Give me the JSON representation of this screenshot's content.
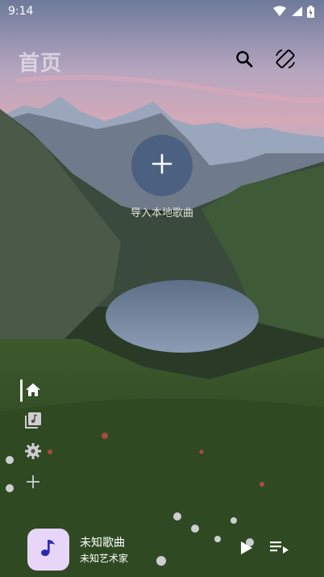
{
  "status_bar": {
    "time": "9:14",
    "icons": [
      "wifi-icon",
      "signal-icon",
      "battery-icon"
    ]
  },
  "header": {
    "title": "首页",
    "actions": [
      "search-icon",
      "screen-rotation-icon"
    ]
  },
  "main": {
    "import_label": "导入本地歌曲",
    "import_icon": "plus-icon",
    "accent": "#4a5c80"
  },
  "side_nav": {
    "items": [
      {
        "icon": "home-icon",
        "selected": true
      },
      {
        "icon": "library-icon",
        "selected": false
      },
      {
        "icon": "settings-gear-icon",
        "selected": false
      },
      {
        "icon": "add-icon",
        "selected": false
      }
    ]
  },
  "player": {
    "title": "未知歌曲",
    "artist": "未知艺术家",
    "album_art_color": "#e8d6f8",
    "controls": [
      "play-icon",
      "playlist-queue-icon"
    ]
  }
}
